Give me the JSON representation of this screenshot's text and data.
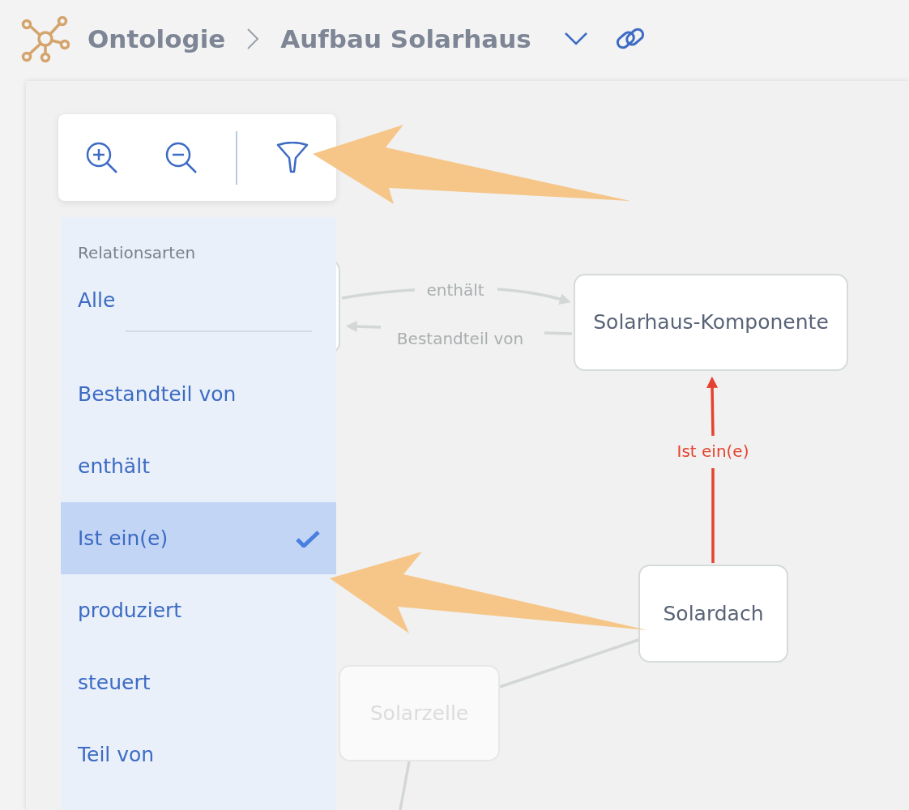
{
  "breadcrumb": [
    "Ontologie",
    "Aufbau Solarhaus"
  ],
  "filter_menu": {
    "heading": "Relationsarten",
    "items": [
      {
        "label": "Alle",
        "kind": "all",
        "selected": false
      },
      {
        "label": "Bestandteil von",
        "kind": "relation",
        "selected": false
      },
      {
        "label": "enthält",
        "kind": "relation",
        "selected": false
      },
      {
        "label": "Ist ein(e)",
        "kind": "relation",
        "selected": true
      },
      {
        "label": "produziert",
        "kind": "relation",
        "selected": false
      },
      {
        "label": "steuert",
        "kind": "relation",
        "selected": false
      },
      {
        "label": "Teil von",
        "kind": "relation",
        "selected": false
      }
    ]
  },
  "graph": {
    "nodes": [
      {
        "faded": false
      },
      {
        "label": "Solarhaus-Komponente",
        "faded": false
      },
      {
        "label": "Solardach",
        "faded": false
      },
      {
        "label": "Solarzelle",
        "faded": true
      }
    ],
    "edges": [
      {
        "label": "enthält",
        "highlighted": false
      },
      {
        "label": "Bestandteil von",
        "highlighted": false
      },
      {
        "label": "Ist ein(e)",
        "highlighted": true
      },
      {
        "highlighted": false
      },
      {
        "highlighted": false
      }
    ]
  }
}
